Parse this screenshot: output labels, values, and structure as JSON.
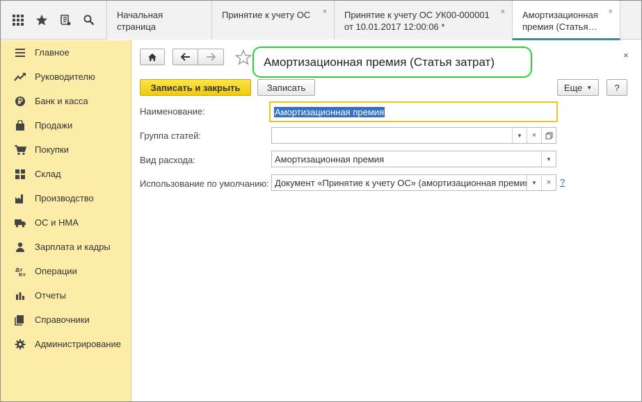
{
  "tabs": [
    {
      "label": "Начальная страница",
      "closable": false,
      "active": false
    },
    {
      "label": "Принятие к учету ОС",
      "closable": true,
      "active": false
    },
    {
      "label": "Принятие к учету ОС УК00-000001 от 10.01.2017 12:00:06 *",
      "line1": "Принятие к учету ОС УК00-000001",
      "line2": "от 10.01.2017 12:00:06 *",
      "closable": true,
      "active": false
    },
    {
      "label": "Амортизационная премия (Статья...",
      "line1": "Амортизационная",
      "line2": "премия (Статья…",
      "closable": true,
      "active": true
    }
  ],
  "tab_close_glyph": "×",
  "top_icons": [
    "apps-grid-icon",
    "star-icon",
    "history-icon",
    "search-icon"
  ],
  "sidebar": {
    "items": [
      {
        "label": "Главное",
        "icon": "menu-lines-icon"
      },
      {
        "label": "Руководителю",
        "icon": "trend-icon"
      },
      {
        "label": "Банк и касса",
        "icon": "ruble-coin-icon"
      },
      {
        "label": "Продажи",
        "icon": "shopping-bag-icon"
      },
      {
        "label": "Покупки",
        "icon": "cart-icon"
      },
      {
        "label": "Склад",
        "icon": "warehouse-icon"
      },
      {
        "label": "Производство",
        "icon": "factory-icon"
      },
      {
        "label": "ОС и НМА",
        "icon": "truck-icon"
      },
      {
        "label": "Зарплата и кадры",
        "icon": "people-icon"
      },
      {
        "label": "Операции",
        "icon": "dt-kt-icon"
      },
      {
        "label": "Отчеты",
        "icon": "bar-chart-icon"
      },
      {
        "label": "Справочники",
        "icon": "books-icon"
      },
      {
        "label": "Администрирование",
        "icon": "gear-icon"
      }
    ]
  },
  "form": {
    "title": "Амортизационная премия (Статья затрат)",
    "close_glyph": "×",
    "buttons": {
      "save_close": "Записать и закрыть",
      "save": "Записать",
      "more": "Еще",
      "help": "?"
    },
    "fields": {
      "name_label": "Наименование:",
      "name_value": "Амортизационная премия",
      "group_label": "Группа статей:",
      "group_value": "",
      "expense_label": "Вид расхода:",
      "expense_value": "Амортизационная премия",
      "default_label": "Использование по умолчанию:",
      "default_value": "Документ «Принятие к учету ОС» (амортизационная премия",
      "default_help": "?"
    }
  },
  "colors": {
    "sidebar_bg": "#fbeda8",
    "primary_button": "#f4d22a",
    "title_highlight": "#2bd42b",
    "selection": "#3370c6",
    "focus_border": "#f0c419"
  }
}
